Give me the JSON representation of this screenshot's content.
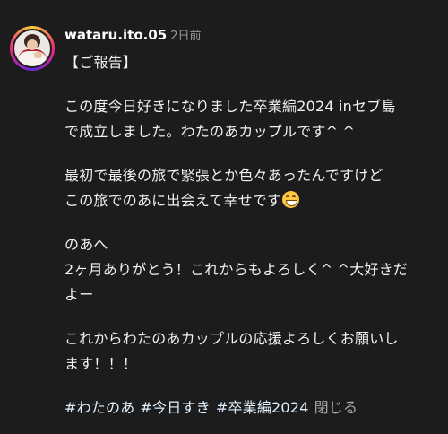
{
  "post": {
    "username": "wataru.ito.05",
    "time": "2日前",
    "lines_1": [
      "【ご報告】"
    ],
    "lines_2": [
      "この度今日好きになりました卒業編2024 inセブ島",
      "で成立しました。わたのあカップルです^ ^"
    ],
    "lines_3": [
      "最初で最後の旅で緊張とか色々あったんですけど",
      "この旅でのあに出会えて幸せです"
    ],
    "emoji": "grinning-face-emoji",
    "lines_4": [
      "のあへ",
      "2ヶ月ありがとう！これからもよろしく^ ^大好きだ",
      "よー"
    ],
    "lines_5": [
      "これからわたのあカップルの応援よろしくお願いし",
      "ます！！！"
    ],
    "hashtags": [
      "#わたのあ",
      "#今日すき",
      "#卒業編2024"
    ],
    "close_label": "閉じる"
  },
  "colors": {
    "background": "#1c1c1c",
    "text": "#f2f2f2",
    "secondary_text": "#9a9a9a",
    "hashtag": "#e0f1ff"
  }
}
